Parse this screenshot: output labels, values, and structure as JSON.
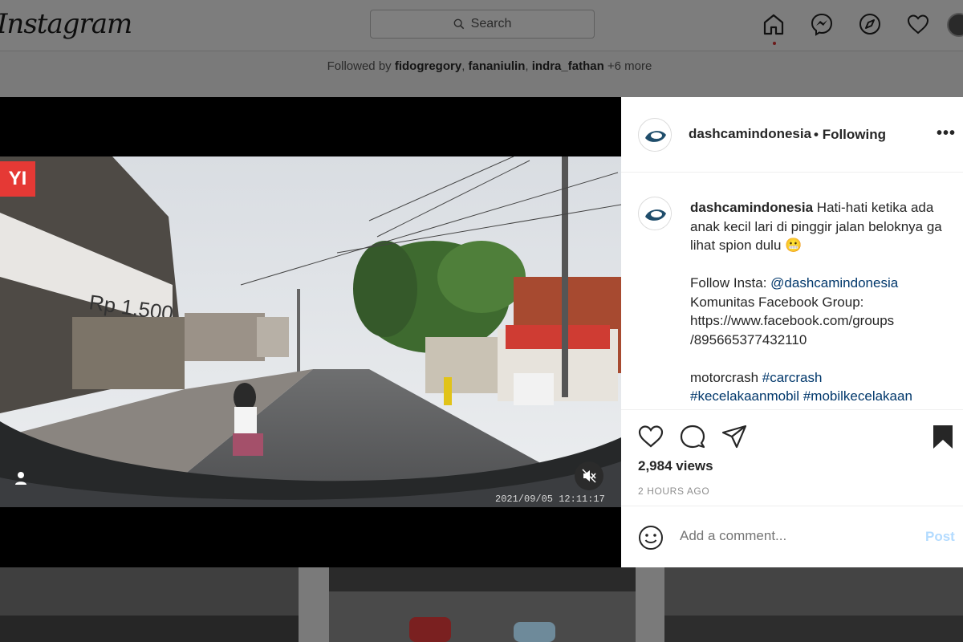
{
  "header": {
    "logo": "Instagram",
    "search_placeholder": "Search",
    "icons": [
      "home-icon",
      "messenger-icon",
      "explore-icon",
      "heart-icon",
      "profile-avatar"
    ]
  },
  "followed": {
    "prefix": "Followed by",
    "names": [
      "fidogregory",
      "fananiulin",
      "indra_fathan"
    ],
    "more": "+6 more"
  },
  "video": {
    "brand_badge": "YI",
    "timestamp": "2021/09/05 12:11:17",
    "muted": true
  },
  "post": {
    "username": "dashcamindonesia",
    "follow_status": "Following",
    "caption_lines": [
      "Hati-hati ketika ada anak kecil lari di pinggir jalan beloknya ga lihat spion dulu 😬"
    ],
    "follow_prefix": "Follow Insta:",
    "follow_handle": "@dashcamindonesia",
    "group_label": "Komunitas Facebook Group:",
    "group_url_1": "https://www.facebook.com/groups",
    "group_url_2": "/895665377432110",
    "tags_word": "motorcrash",
    "tag1": "#carcrash",
    "tag2": "#kecelakaanmobil",
    "tag3": "#mobilkecelakaan",
    "views": "2,984 views",
    "time_ago": "2 HOURS AGO"
  },
  "comment": {
    "placeholder": "Add a comment...",
    "post_label": "Post"
  },
  "colors": {
    "link": "#00376b",
    "post_disabled": "#b3dbff",
    "badge": "#e53935"
  }
}
